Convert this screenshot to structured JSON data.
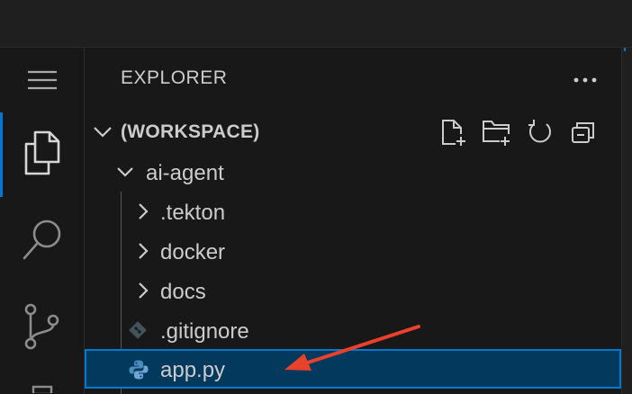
{
  "explorer": {
    "title": "EXPLORER"
  },
  "workspace": {
    "label": "(WORKSPACE)",
    "actions": [
      "new-file-icon",
      "new-folder-icon",
      "refresh-icon",
      "collapse-all-icon"
    ]
  },
  "tree": {
    "root": {
      "label": "ai-agent",
      "expanded": true
    },
    "items": [
      {
        "label": ".tekton",
        "kind": "folder"
      },
      {
        "label": "docker",
        "kind": "folder"
      },
      {
        "label": "docs",
        "kind": "folder"
      },
      {
        "label": ".gitignore",
        "kind": "file",
        "icon": "git-icon"
      },
      {
        "label": "app.py",
        "kind": "file",
        "icon": "python-icon",
        "selected": true
      }
    ]
  },
  "activity_bar": {
    "items": [
      "menu-icon",
      "files-icon",
      "search-icon",
      "source-control-icon"
    ],
    "active": "files-icon"
  },
  "colors": {
    "accent": "#0078d4",
    "selection_bg": "#04395e",
    "annotation_arrow": "#e8412c"
  }
}
